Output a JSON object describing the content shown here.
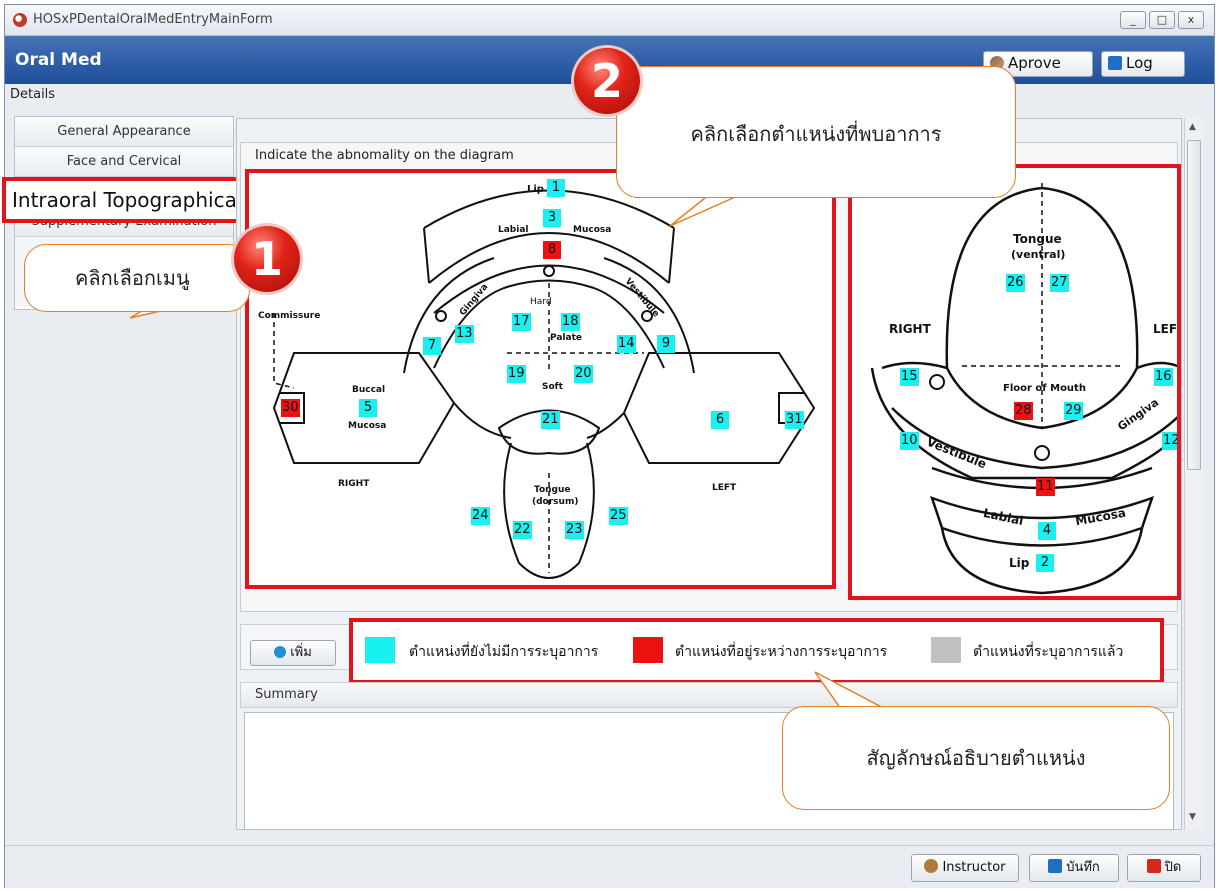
{
  "window": {
    "title": "HOSxPDentalOralMedEntryMainForm",
    "controls": [
      "_",
      "□",
      "x"
    ]
  },
  "header": {
    "title": "Oral Med",
    "approve_label": "Aprove",
    "log_label": "Log"
  },
  "details_label": "Details",
  "menu": {
    "items": [
      "General Appearance",
      "Face and Cervical",
      "Intraoral Topographical",
      "Supplementary Examination"
    ],
    "selected": "Intraoral Topographical"
  },
  "callouts": {
    "step1": {
      "number": "1",
      "text": "คลิกเลือกเมนู"
    },
    "step2": {
      "number": "2",
      "text": "คลิกเลือกตำแหน่งที่พบอาการ"
    },
    "legend_note": "สัญลักษณ์อธิบายตำแหน่ง"
  },
  "diagram": {
    "caption": "Indicate the  abnomality on the diagram",
    "left_labels": {
      "lip": "Lip",
      "labial": "Labial",
      "mucosa": "Mucosa",
      "commissure": "Commissure",
      "buccal": "Buccal",
      "buccal_mucosa": "Mucosa",
      "hard": "Hard",
      "palate": "Palate",
      "soft": "Soft",
      "gingiva": "Gingiva",
      "vestibule": "Vestibule",
      "tongue": "Tongue",
      "dorsum": "(dorsum)",
      "right": "RIGHT",
      "left": "LEFT"
    },
    "right_labels": {
      "tongue": "Tongue",
      "ventral": "(ventral)",
      "right": "RIGHT",
      "left": "LEF",
      "floor": "Floor of Mouth",
      "gingiva": "Gingiva",
      "vestibule": "Vestibule",
      "labial": "Labial",
      "mucosa": "Mucosa",
      "lip": "Lip"
    },
    "left_markers": [
      "1",
      "3",
      "8",
      "17",
      "18",
      "13",
      "7",
      "14",
      "9",
      "19",
      "20",
      "30",
      "5",
      "21",
      "6",
      "31",
      "24",
      "22",
      "23",
      "25"
    ],
    "right_markers": [
      "26",
      "27",
      "15",
      "16",
      "28",
      "29",
      "10",
      "12",
      "11",
      "4",
      "2"
    ],
    "selected_markers": [
      "8",
      "30",
      "28",
      "11"
    ]
  },
  "legend": {
    "add_label": "เพิ่ม",
    "unspecified": "ตำแหน่งที่ยังไม่มีการระบุอาการ",
    "in_progress": "ตำแหน่งที่อยู่ระหว่างการระบุอาการ",
    "specified": "ตำแหน่งที่ระบุอาการแล้ว",
    "colors": {
      "unspecified": "#19f0f0",
      "in_progress": "#ee1111",
      "specified": "#c0c0c0"
    }
  },
  "summary": {
    "label": "Summary",
    "value": ""
  },
  "footer": {
    "instructor_label": "Instructor",
    "save_label": "บันทึก",
    "close_label": "ปิด"
  }
}
